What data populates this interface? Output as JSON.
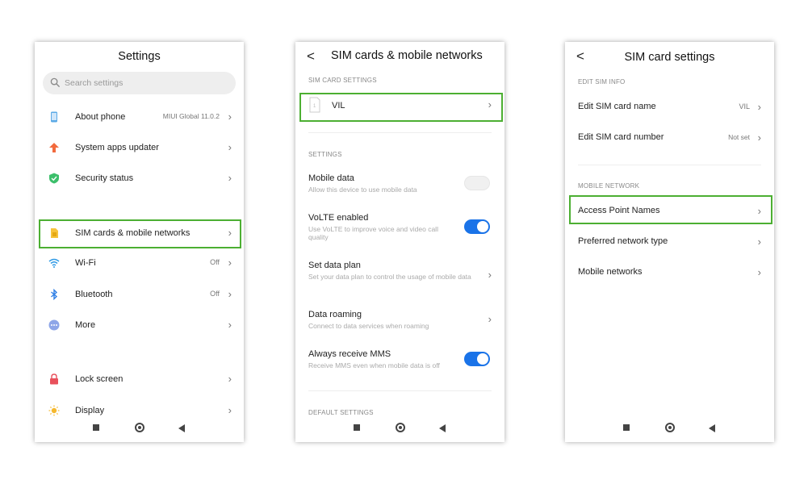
{
  "screen1": {
    "title": "Settings",
    "search_placeholder": "Search settings",
    "items": [
      {
        "label": "About phone",
        "value": "MIUI Global 11.0.2",
        "icon": "phone-icon"
      },
      {
        "label": "System apps updater",
        "value": "",
        "icon": "arrow-up-icon"
      },
      {
        "label": "Security status",
        "value": "",
        "icon": "shield-check-icon"
      },
      {
        "label": "SIM cards & mobile networks",
        "value": "",
        "icon": "sim-card-icon"
      },
      {
        "label": "Wi-Fi",
        "value": "Off",
        "icon": "wifi-icon"
      },
      {
        "label": "Bluetooth",
        "value": "Off",
        "icon": "bluetooth-icon"
      },
      {
        "label": "More",
        "value": "",
        "icon": "more-dots-icon"
      },
      {
        "label": "Lock screen",
        "value": "",
        "icon": "lock-icon"
      },
      {
        "label": "Display",
        "value": "",
        "icon": "sun-icon"
      }
    ]
  },
  "screen2": {
    "title": "SIM cards & mobile networks",
    "section_sim": "SIM CARD SETTINGS",
    "sim_name": "VIL",
    "section_settings": "SETTINGS",
    "settings": [
      {
        "title": "Mobile data",
        "subtitle": "Allow this device to use mobile data",
        "control": "toggle",
        "on": false
      },
      {
        "title": "VoLTE enabled",
        "subtitle": "Use VoLTE to improve voice and video call quality",
        "control": "toggle",
        "on": true
      },
      {
        "title": "Set data plan",
        "subtitle": "Set your data plan to control the usage of mobile data",
        "control": "chevron"
      },
      {
        "title": "Data roaming",
        "subtitle": "Connect to data services when roaming",
        "control": "chevron"
      },
      {
        "title": "Always receive MMS",
        "subtitle": "Receive MMS even when mobile data is off",
        "control": "toggle",
        "on": true
      }
    ],
    "section_default": "DEFAULT SETTINGS"
  },
  "screen3": {
    "title": "SIM card settings",
    "section_edit": "EDIT SIM INFO",
    "edit_items": [
      {
        "label": "Edit SIM card name",
        "value": "VIL"
      },
      {
        "label": "Edit SIM card number",
        "value": "Not set"
      }
    ],
    "section_network": "MOBILE NETWORK",
    "network_items": [
      {
        "label": "Access Point Names",
        "value": ""
      },
      {
        "label": "Preferred network type",
        "value": ""
      },
      {
        "label": "Mobile networks",
        "value": ""
      }
    ]
  },
  "glyphs": {
    "chevron": "›",
    "back": "<"
  },
  "colors": {
    "highlight": "#4caf32",
    "toggle_on": "#1a73e8"
  }
}
